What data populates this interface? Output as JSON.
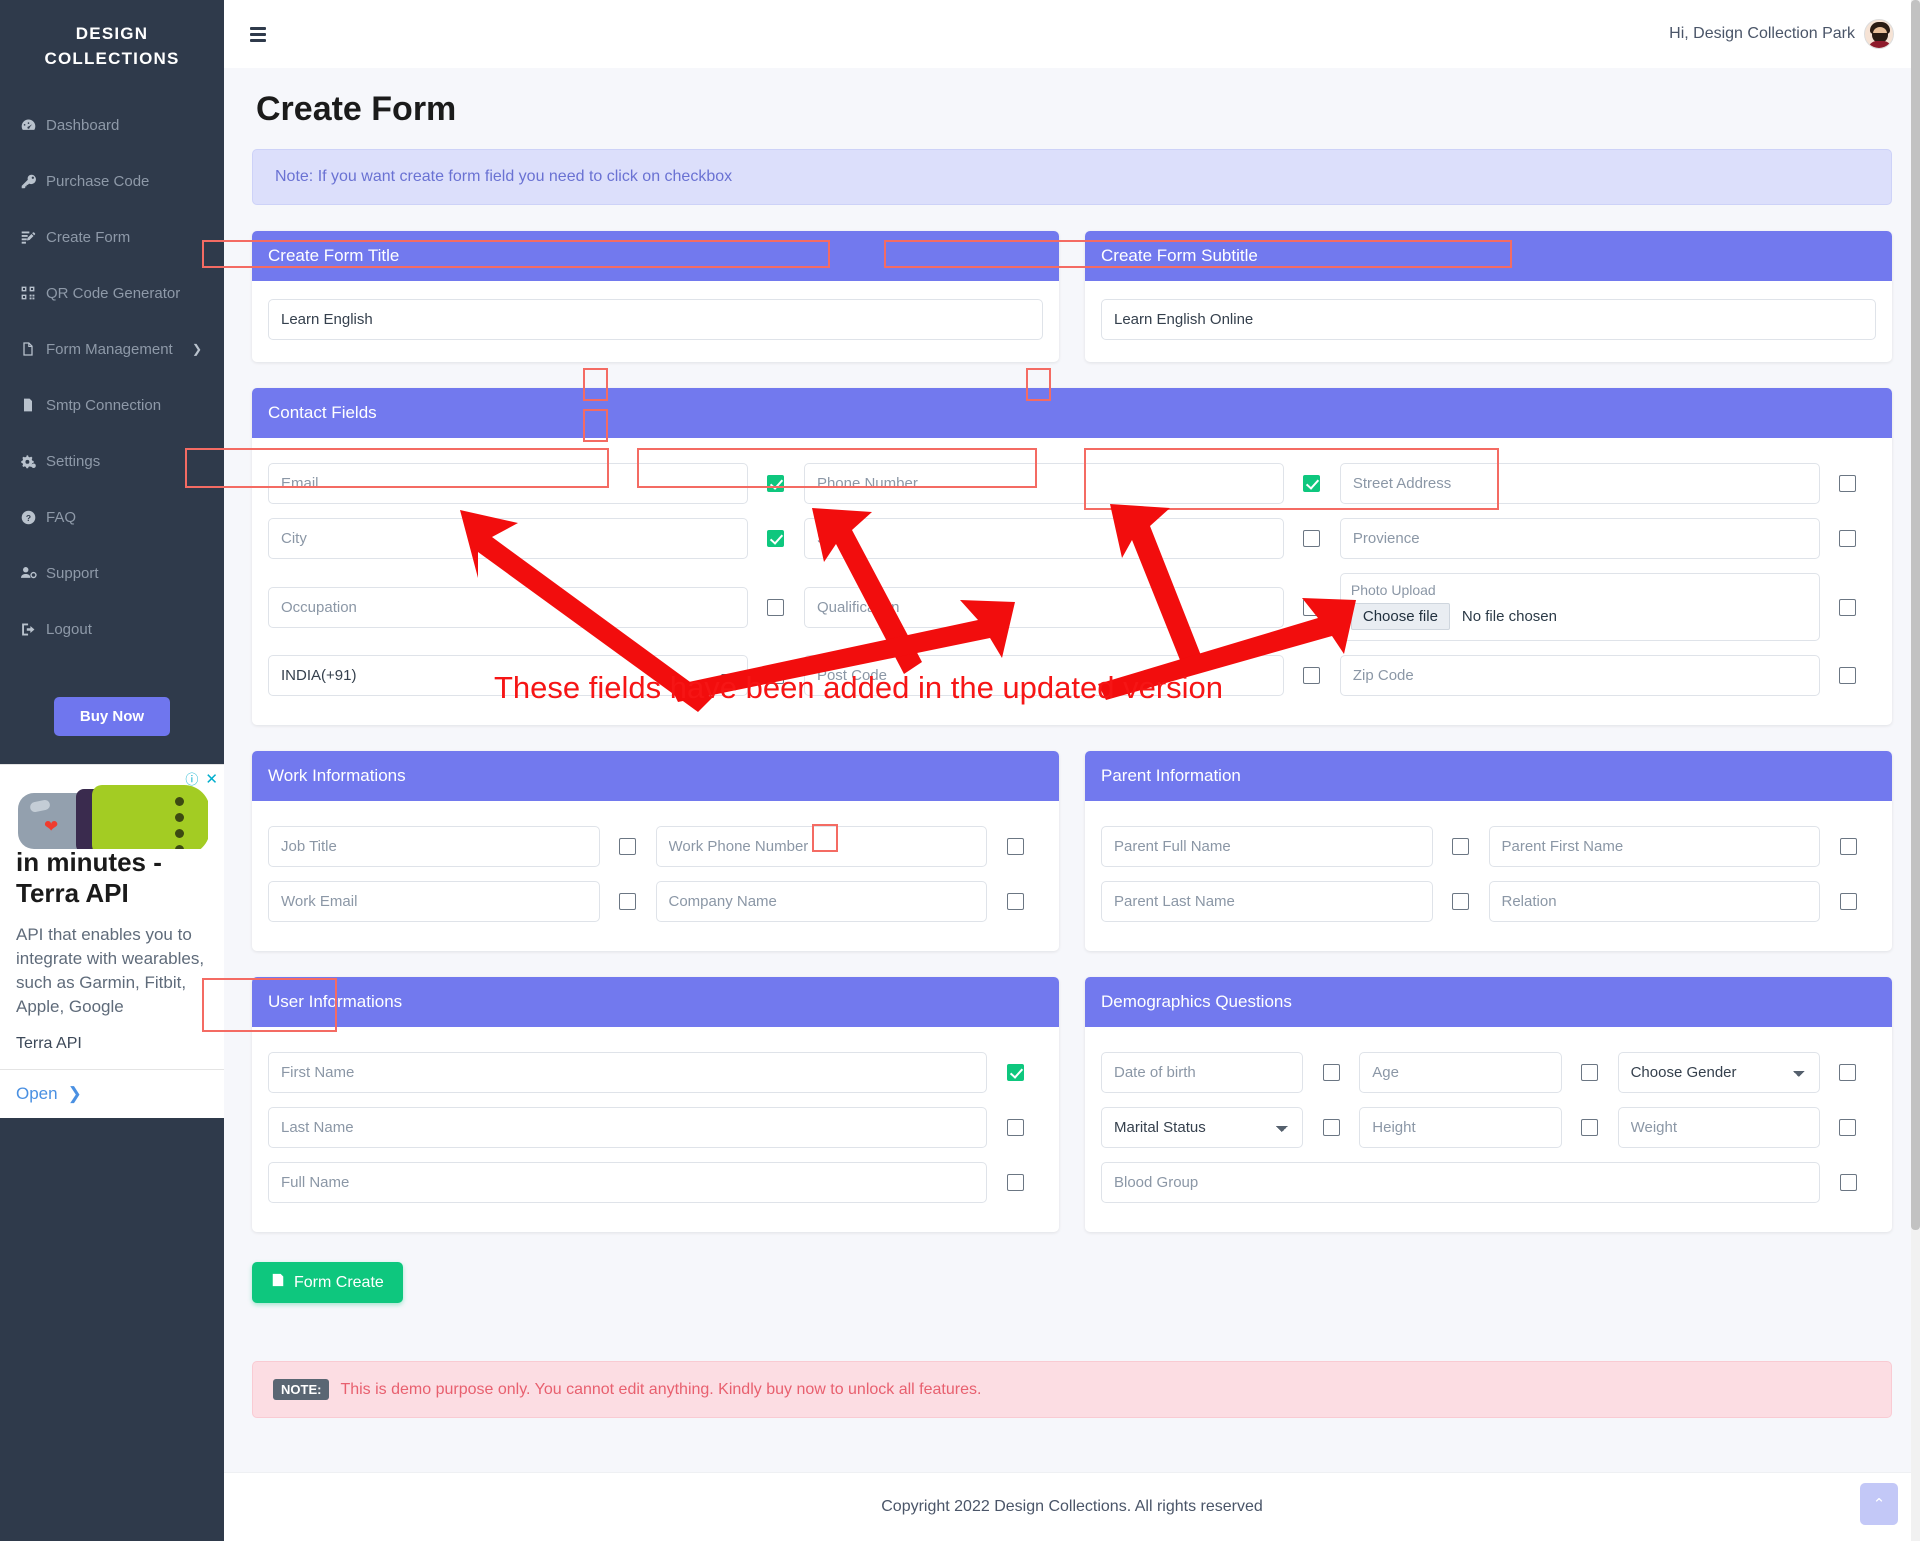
{
  "sidebar": {
    "brand_line1": "DESIGN",
    "brand_line2": "COLLECTIONS",
    "items": [
      {
        "label": "Dashboard",
        "icon": "dashboard-icon"
      },
      {
        "label": "Purchase Code",
        "icon": "key-icon"
      },
      {
        "label": "Create Form",
        "icon": "form-edit-icon"
      },
      {
        "label": "QR Code Generator",
        "icon": "qrcode-icon"
      },
      {
        "label": "Form Management",
        "icon": "file-icon",
        "chevron": "❯"
      },
      {
        "label": "Smtp Connection",
        "icon": "mail-doc-icon"
      },
      {
        "label": "Settings",
        "icon": "gears-icon"
      },
      {
        "label": "FAQ",
        "icon": "question-icon"
      },
      {
        "label": "Support",
        "icon": "user-support-icon"
      },
      {
        "label": "Logout",
        "icon": "logout-icon"
      }
    ],
    "buy_now": "Buy Now"
  },
  "ad": {
    "title": "in minutes - Terra API",
    "description": "API that enables you to integrate with wearables, such as Garmin, Fitbit, Apple, Google",
    "brand": "Terra API",
    "open_label": "Open",
    "info_icon": "ⓘ",
    "close_icon": "✕"
  },
  "topbar": {
    "greeting": "Hi, Design Collection Park"
  },
  "page": {
    "title": "Create Form",
    "note_top": "Note: If you want create form field you need to click on checkbox",
    "annotation": "These fields have been added in the updated version"
  },
  "title_card": {
    "head": "Create Form Title",
    "value": "Learn English"
  },
  "subtitle_card": {
    "head": "Create Form Subtitle",
    "value": "Learn English Online"
  },
  "contact_fields": {
    "head": "Contact Fields",
    "fields": [
      {
        "placeholder": "Email",
        "checked": true,
        "type": "text"
      },
      {
        "placeholder": "Phone Number",
        "checked": true,
        "type": "text"
      },
      {
        "placeholder": "Street Address",
        "checked": false,
        "type": "text"
      },
      {
        "placeholder": "City",
        "checked": true,
        "type": "text"
      },
      {
        "placeholder": "State",
        "checked": false,
        "type": "text"
      },
      {
        "placeholder": "Provience",
        "checked": false,
        "type": "text"
      },
      {
        "placeholder": "Occupation",
        "checked": false,
        "type": "text"
      },
      {
        "placeholder": "Qualification",
        "checked": false,
        "type": "text"
      },
      {
        "placeholder": "Photo Upload",
        "checked": false,
        "type": "file"
      },
      {
        "placeholder": "INDIA(+91)",
        "checked": false,
        "type": "select"
      },
      {
        "placeholder": "Post Code",
        "checked": false,
        "type": "text"
      },
      {
        "placeholder": "Zip Code",
        "checked": false,
        "type": "text"
      }
    ],
    "file": {
      "label": "Photo Upload",
      "button": "Choose file",
      "status": "No file chosen"
    }
  },
  "work_info": {
    "head": "Work Informations",
    "fields": [
      {
        "placeholder": "Job Title",
        "checked": false
      },
      {
        "placeholder": "Work Phone Number",
        "checked": false
      },
      {
        "placeholder": "Work Email",
        "checked": false
      },
      {
        "placeholder": "Company Name",
        "checked": false
      }
    ]
  },
  "parent_info": {
    "head": "Parent Information",
    "fields": [
      {
        "placeholder": "Parent Full Name",
        "checked": false
      },
      {
        "placeholder": "Parent First Name",
        "checked": false
      },
      {
        "placeholder": "Parent Last Name",
        "checked": false
      },
      {
        "placeholder": "Relation",
        "checked": false
      }
    ]
  },
  "user_info": {
    "head": "User Informations",
    "fields": [
      {
        "placeholder": "First Name",
        "checked": true
      },
      {
        "placeholder": "Last Name",
        "checked": false
      },
      {
        "placeholder": "Full Name",
        "checked": false
      }
    ]
  },
  "demographics": {
    "head": "Demographics Questions",
    "fields": [
      {
        "placeholder": "Date of birth",
        "checked": false,
        "type": "text"
      },
      {
        "placeholder": "Age",
        "checked": false,
        "type": "text"
      },
      {
        "placeholder": "Choose Gender",
        "checked": false,
        "type": "select"
      },
      {
        "placeholder": "Marital Status",
        "checked": false,
        "type": "select"
      },
      {
        "placeholder": "Height",
        "checked": false,
        "type": "text"
      },
      {
        "placeholder": "Weight",
        "checked": false,
        "type": "text"
      },
      {
        "placeholder": "Blood Group",
        "checked": false,
        "type": "text"
      }
    ]
  },
  "actions": {
    "form_create": "Form Create",
    "save_icon": "save-icon"
  },
  "note_bottom": {
    "badge": "NOTE:",
    "text": "This is demo purpose only. You cannot edit anything. Kindly buy now to unlock all features."
  },
  "footer": {
    "copyright": "Copyright 2022 Design Collections. All rights reserved",
    "to_top_icon": "⌃"
  },
  "colors": {
    "sidebar_bg": "#2f3a4b",
    "accent_purple": "#7279ee",
    "checkbox_green": "#0ec77e",
    "annotation_red": "#f61515",
    "highlight_red": "#f46b63"
  }
}
